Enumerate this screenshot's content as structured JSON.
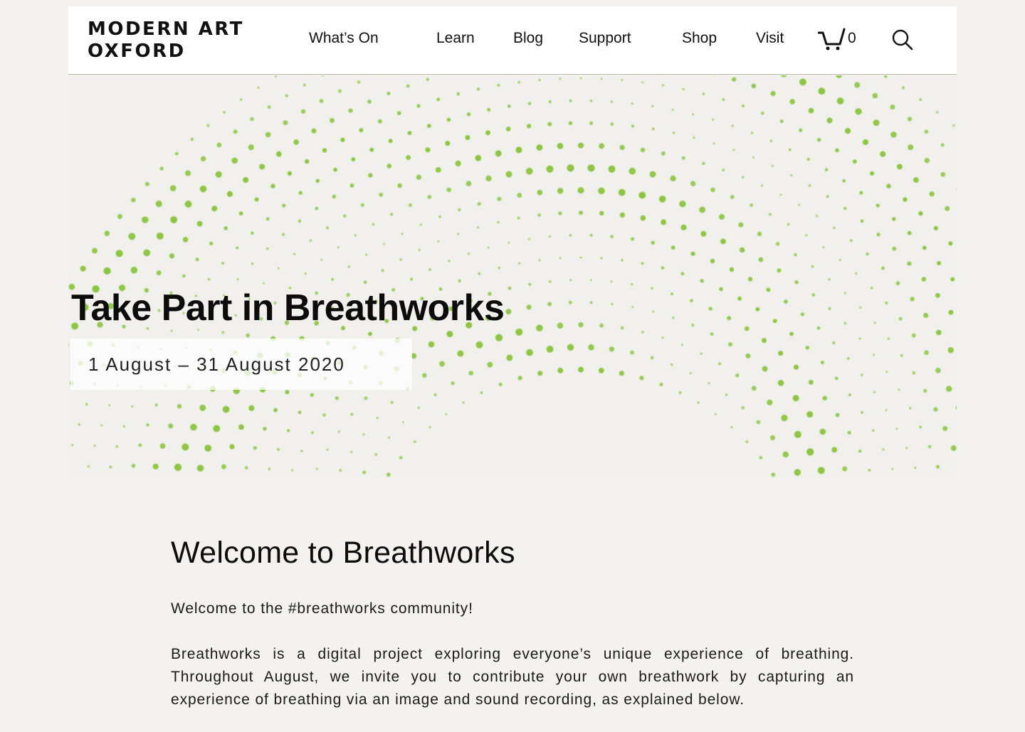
{
  "header": {
    "logo_line1": "MODERN ART",
    "logo_line2": "OXFORD",
    "nav": [
      {
        "label": "What’s On"
      },
      {
        "label": "Learn"
      },
      {
        "label": "Blog"
      },
      {
        "label": "Support"
      },
      {
        "label": "Shop"
      },
      {
        "label": "Visit"
      }
    ],
    "cart_count": "0",
    "cart_icon": "cart-icon",
    "search_icon": "search-icon"
  },
  "hero": {
    "title": "Take Part in Breathworks",
    "dates": "1 August – 31 August 2020",
    "dot_color": "#8cc63f"
  },
  "content": {
    "heading": "Welcome to Breathworks",
    "paragraph1": "Welcome to the #breathworks community!",
    "paragraph2": "Breathworks is a digital project exploring everyone’s unique experience of breathing. Throughout August, we invite you to contribute your own breathwork by capturing an experience of breathing via an image and sound recording, as explained below."
  }
}
